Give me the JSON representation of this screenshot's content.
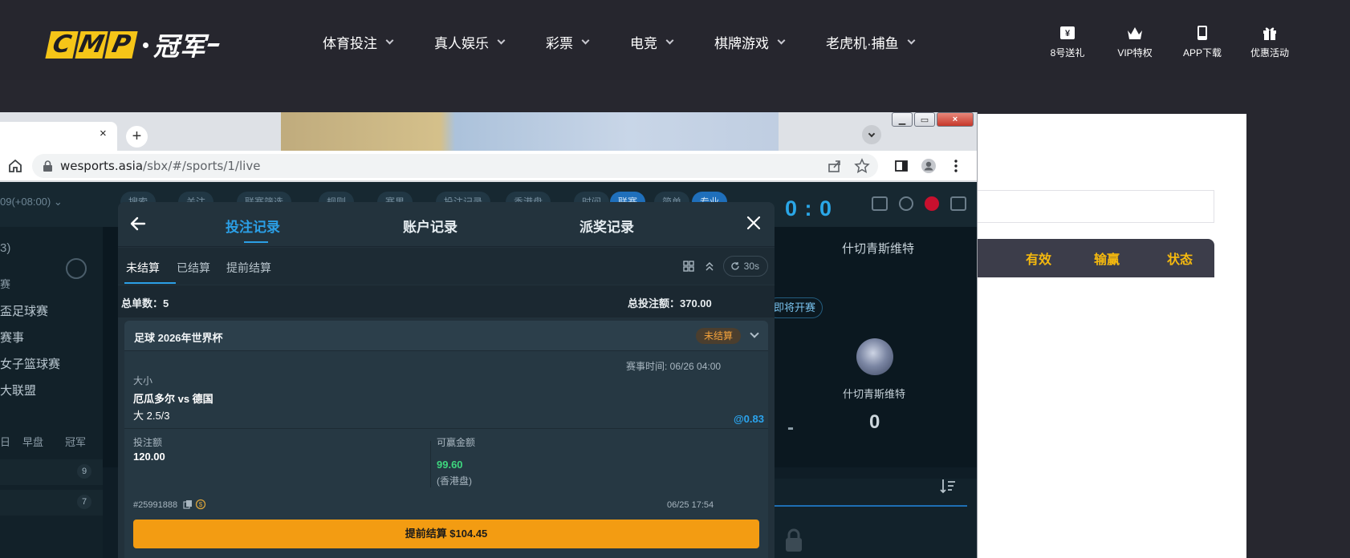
{
  "site": {
    "logo_mark": "CMP",
    "logo_text": "冠军",
    "nav": [
      "体育投注",
      "真人娱乐",
      "彩票",
      "电竞",
      "棋牌游戏",
      "老虎机·捕鱼"
    ],
    "actions": [
      {
        "label": "8号送礼",
        "icon": "ticket-icon"
      },
      {
        "label": "VIP特权",
        "icon": "crown-icon"
      },
      {
        "label": "APP下载",
        "icon": "mobile-icon"
      },
      {
        "label": "优惠活动",
        "icon": "gift-icon"
      }
    ],
    "table_headers": [
      "有效",
      "输赢",
      "状态"
    ]
  },
  "browser": {
    "tab_close": "×",
    "new_tab": "+",
    "url_host": "wesports.asia",
    "url_path": "/sbx/#/sports/1/live",
    "window_close": "×"
  },
  "sportsbook": {
    "timezone": "09(+08:00) ⌄",
    "top_pills": [
      "搜索",
      "关注",
      "联赛筛选",
      "规则",
      "赛果",
      "投注记录",
      "香港盘",
      "时间",
      "联赛",
      "简单",
      "专业"
    ],
    "sidebar_count": "3)",
    "sidebar_section": "赛",
    "sidebar_items": [
      "盃足球赛",
      "赛事",
      "女子篮球赛",
      "大联盟"
    ],
    "sidebar_tabs": [
      "日",
      "早盘",
      "冠军"
    ],
    "badges": [
      "9",
      "7"
    ],
    "score": "0 : 0",
    "team_right": "什切青斯维特",
    "upcoming": "即将开赛",
    "team_right_small": "什切青斯维特",
    "team_score": "0",
    "dash": "-"
  },
  "modal": {
    "tabs": [
      "投注记录",
      "账户记录",
      "派奖记录"
    ],
    "active_tab": 0,
    "subtabs": [
      "未结算",
      "已结算",
      "提前结算"
    ],
    "refresh_label": "30s",
    "total_orders_label": "总单数：5",
    "total_stake_label": "总投注额：370.00",
    "bet": {
      "title": "足球 2026年世界杯",
      "status": "未结算",
      "match_time": "赛事时间: 06/26 04:00",
      "market": "大小",
      "match": "厄瓜多尔 vs 德国",
      "selection": "大 2.5/3",
      "odds": "@0.83",
      "stake_label": "投注额",
      "stake": "120.00",
      "win_label": "可赢金额",
      "win": "99.60",
      "odds_type": "(香港盘)",
      "ticket_id": "#25991888",
      "placed_time": "06/25 17:54",
      "cashout": "提前结算 $104.45"
    }
  }
}
